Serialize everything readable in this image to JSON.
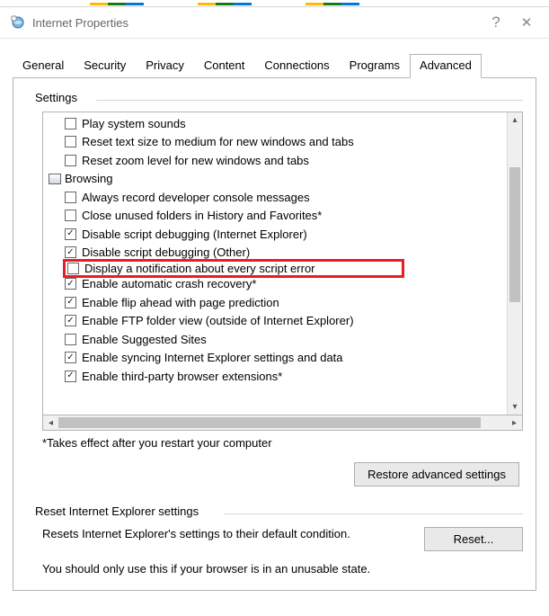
{
  "title": "Internet Properties",
  "help_symbol": "?",
  "close_symbol": "✕",
  "tabs": {
    "general": "General",
    "security": "Security",
    "privacy": "Privacy",
    "content": "Content",
    "connections": "Connections",
    "programs": "Programs",
    "advanced": "Advanced"
  },
  "settings_label": "Settings",
  "items": [
    {
      "type": "chk",
      "checked": false,
      "label": "Play system sounds"
    },
    {
      "type": "chk",
      "checked": false,
      "label": "Reset text size to medium for new windows and tabs"
    },
    {
      "type": "chk",
      "checked": false,
      "label": "Reset zoom level for new windows and tabs"
    },
    {
      "type": "cat",
      "label": "Browsing"
    },
    {
      "type": "chk",
      "checked": false,
      "label": "Always record developer console messages"
    },
    {
      "type": "chk",
      "checked": false,
      "label": "Close unused folders in History and Favorites*"
    },
    {
      "type": "chk",
      "checked": true,
      "label": "Disable script debugging (Internet Explorer)"
    },
    {
      "type": "chk",
      "checked": true,
      "label": "Disable script debugging (Other)"
    },
    {
      "type": "chk",
      "checked": false,
      "label": "Display a notification about every script error",
      "highlight": true
    },
    {
      "type": "chk",
      "checked": true,
      "label": "Enable automatic crash recovery*"
    },
    {
      "type": "chk",
      "checked": true,
      "label": "Enable flip ahead with page prediction"
    },
    {
      "type": "chk",
      "checked": true,
      "label": "Enable FTP folder view (outside of Internet Explorer)"
    },
    {
      "type": "chk",
      "checked": false,
      "label": "Enable Suggested Sites"
    },
    {
      "type": "chk",
      "checked": true,
      "label": "Enable syncing Internet Explorer settings and data"
    },
    {
      "type": "chk",
      "checked": true,
      "label": "Enable third-party browser extensions*"
    }
  ],
  "footnote": "*Takes effect after you restart your computer",
  "restore_label": "Restore advanced settings",
  "reset_group": "Reset Internet Explorer settings",
  "reset_desc": "Resets Internet Explorer's settings to their default condition.",
  "reset_button": "Reset...",
  "reset_warn": "You should only use this if your browser is in an unusable state."
}
